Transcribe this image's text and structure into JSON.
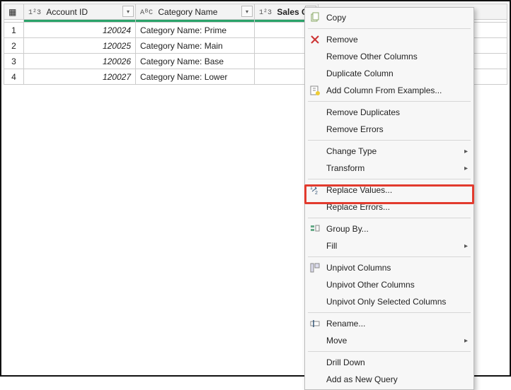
{
  "columns": {
    "col1": {
      "type_icon": "1²3",
      "label": "Account ID"
    },
    "col2": {
      "type_icon": "AᴮC",
      "label": "Category Name"
    },
    "col3": {
      "type_icon": "1²3",
      "label": "Sales Goal",
      "selected": true
    }
  },
  "rows": [
    {
      "n": "1",
      "id": "120024",
      "cat": "Category Name: Prime"
    },
    {
      "n": "2",
      "id": "120025",
      "cat": "Category Name: Main"
    },
    {
      "n": "3",
      "id": "120026",
      "cat": "Category Name: Base"
    },
    {
      "n": "4",
      "id": "120027",
      "cat": "Category Name: Lower"
    }
  ],
  "menu": {
    "copy": "Copy",
    "remove": "Remove",
    "remove_other": "Remove Other Columns",
    "duplicate": "Duplicate Column",
    "add_examples": "Add Column From Examples...",
    "remove_dupes": "Remove Duplicates",
    "remove_errors": "Remove Errors",
    "change_type": "Change Type",
    "transform": "Transform",
    "replace_values": "Replace Values...",
    "replace_errors": "Replace Errors...",
    "group_by": "Group By...",
    "fill": "Fill",
    "unpivot": "Unpivot Columns",
    "unpivot_other": "Unpivot Other Columns",
    "unpivot_sel": "Unpivot Only Selected Columns",
    "rename": "Rename...",
    "move": "Move",
    "drill": "Drill Down",
    "add_query": "Add as New Query"
  }
}
